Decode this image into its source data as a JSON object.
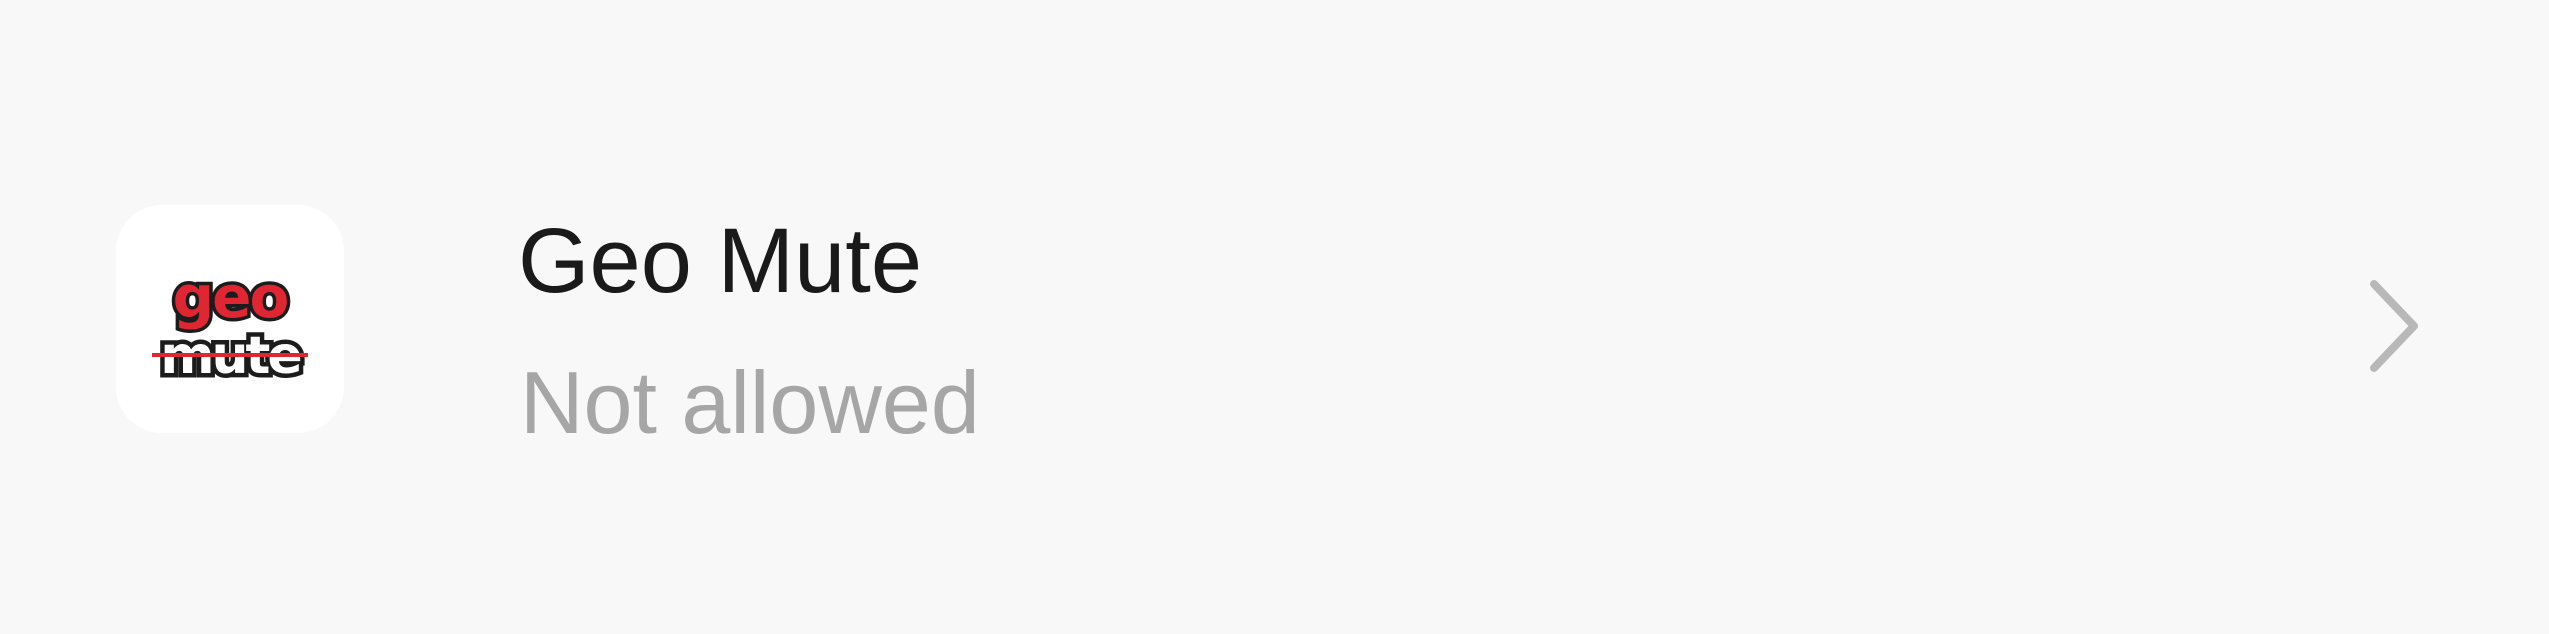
{
  "app": {
    "name": "Geo Mute",
    "status": "Not allowed",
    "icon": "geo-mute-app-logo",
    "logo_text_top": "geo",
    "logo_text_bottom": "mute"
  },
  "row_action_icon": "chevron-right-icon",
  "colors": {
    "background": "#f8f8f8",
    "title": "#1a1a1a",
    "subtitle": "#a6a6a6",
    "chevron": "#b8b8b8",
    "logo_red": "#e02633",
    "logo_dark": "#1c1c1c"
  }
}
